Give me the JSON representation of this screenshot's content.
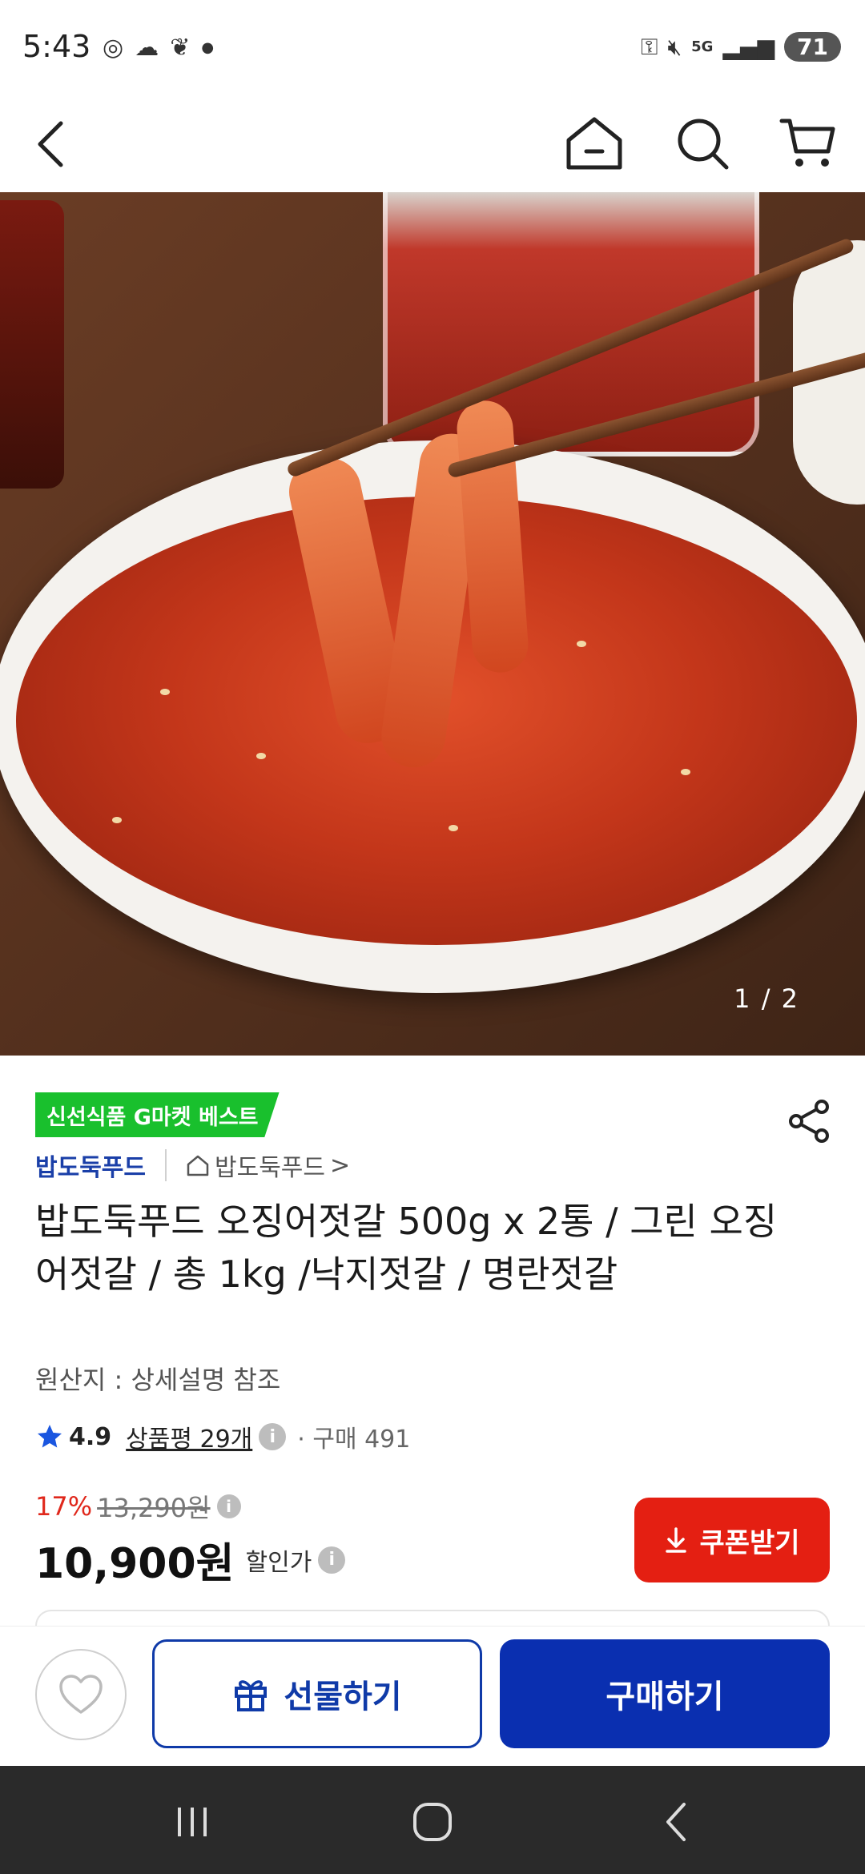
{
  "status_bar": {
    "time": "5:43",
    "battery": "71",
    "icons": [
      "chrome-icon",
      "cloud-icon",
      "leaf-icon",
      "dot-icon",
      "key-icon",
      "mute-icon",
      "5g-icon",
      "signal-icon"
    ]
  },
  "nav": {
    "back_icon": "back-arrow-icon",
    "home_icon": "home-icon",
    "search_icon": "search-icon",
    "cart_icon": "cart-icon"
  },
  "hero": {
    "page_indicator": "1 / 2"
  },
  "product": {
    "badge": "신선식품 G마켓 베스트",
    "brand": "밥도둑푸드",
    "store": "밥도둑푸드",
    "store_chevron": ">",
    "title": "밥도둑푸드 오징어젓갈 500g x 2통 / 그린 오징어젓갈 / 총 1kg /낙지젓갈 / 명란젓갈",
    "origin": "원산지 : 상세설명 참조",
    "rating": "4.9",
    "reviews": "상품평 29개",
    "purchases": "· 구매 491",
    "discount": "17%",
    "original_price": "13,290원",
    "price": "10,900원",
    "price_label": "할인가",
    "info_symbol": "i",
    "coupon": "쿠폰받기"
  },
  "actions": {
    "gift": "선물하기",
    "buy": "구매하기"
  },
  "colors": {
    "badge_green": "#19c02d",
    "brand_blue": "#1a3fa8",
    "discount_red": "#e0281c",
    "coupon_red": "#e41f12",
    "buy_blue": "#0a2fb0",
    "star_blue": "#1a56e0"
  }
}
